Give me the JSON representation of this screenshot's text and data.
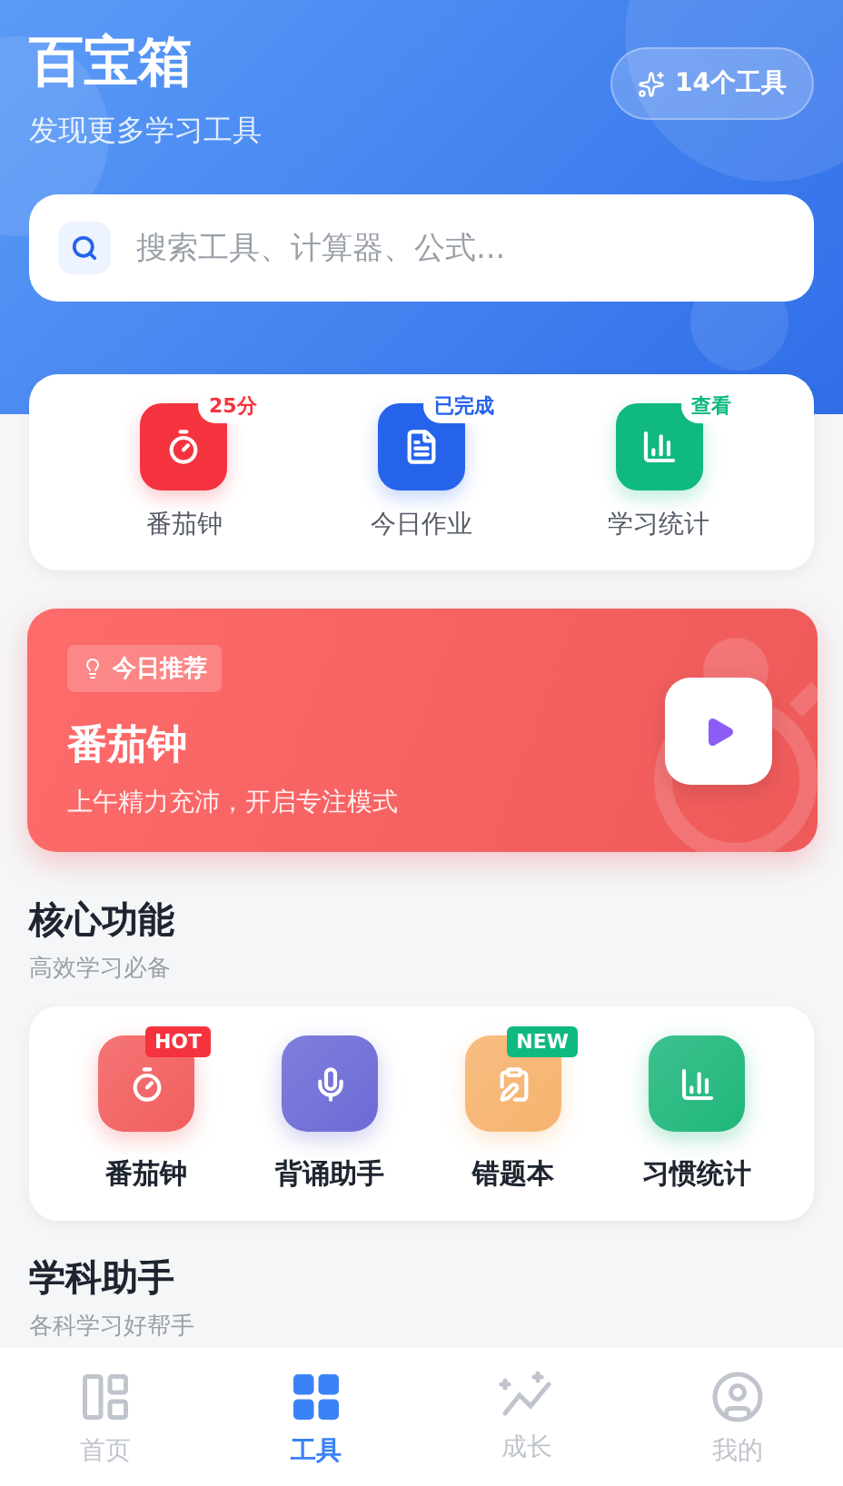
{
  "header": {
    "title": "百宝箱",
    "subtitle": "发现更多学习工具",
    "badge": "14个工具"
  },
  "search": {
    "placeholder": "搜索工具、计算器、公式..."
  },
  "quick_tools": [
    {
      "label": "番茄钟",
      "tag": "25分",
      "color": "#f5333f"
    },
    {
      "label": "今日作业",
      "tag": "已完成",
      "color": "#2563eb"
    },
    {
      "label": "学习统计",
      "tag": "查看",
      "color": "#10b981"
    }
  ],
  "recommendation": {
    "tag": "今日推荐",
    "title": "番茄钟",
    "subtitle": "上午精力充沛，开启专注模式"
  },
  "core_section": {
    "title": "核心功能",
    "subtitle": "高效学习必备"
  },
  "core_tools": [
    {
      "label": "番茄钟",
      "color": "#f25f5f",
      "badge": {
        "text": "HOT",
        "kind": "hot"
      }
    },
    {
      "label": "背诵助手",
      "color": "#6c6bd6"
    },
    {
      "label": "错题本",
      "color": "#f6b36e",
      "badge": {
        "text": "NEW",
        "kind": "new"
      }
    },
    {
      "label": "习惯统计",
      "color": "#1fb77c"
    }
  ],
  "subject_section": {
    "title": "学科助手",
    "subtitle": "各科学习好帮手"
  },
  "tab_bar": [
    {
      "label": "首页",
      "selected": false
    },
    {
      "label": "工具",
      "selected": true
    },
    {
      "label": "成长",
      "selected": false
    },
    {
      "label": "我的",
      "selected": false
    }
  ]
}
